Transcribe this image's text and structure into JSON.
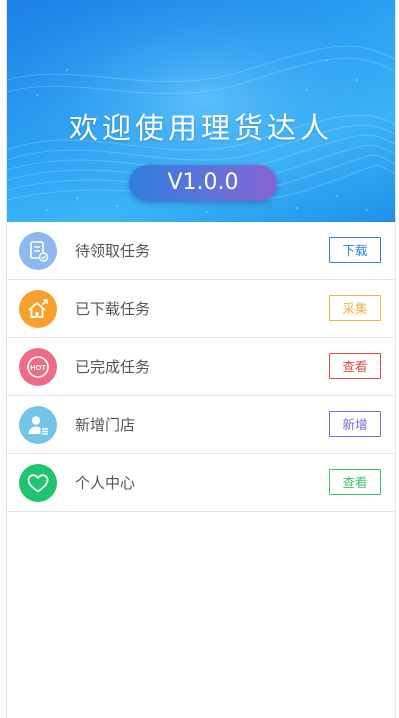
{
  "banner": {
    "title": "欢迎使用理货达人",
    "version": "V1.0.0"
  },
  "menu": {
    "items": [
      {
        "label": "待领取任务",
        "button": "下载",
        "icon": "task-list-icon",
        "icon_color": "#8fb8ef",
        "button_color": "#2e86de"
      },
      {
        "label": "已下载任务",
        "button": "采集",
        "icon": "home-upload-icon",
        "icon_color": "#f7a02c",
        "button_color": "#f0b44a"
      },
      {
        "label": "已完成任务",
        "button": "查看",
        "icon": "hot-badge-icon",
        "icon_color": "#ee6d86",
        "button_color": "#e04a4a"
      },
      {
        "label": "新增门店",
        "button": "新增",
        "icon": "user-add-icon",
        "icon_color": "#74c4e6",
        "button_color": "#7a69d6"
      },
      {
        "label": "个人中心",
        "button": "查看",
        "icon": "heart-icon",
        "icon_color": "#1ec46e",
        "button_color": "#3cc46b"
      }
    ]
  }
}
